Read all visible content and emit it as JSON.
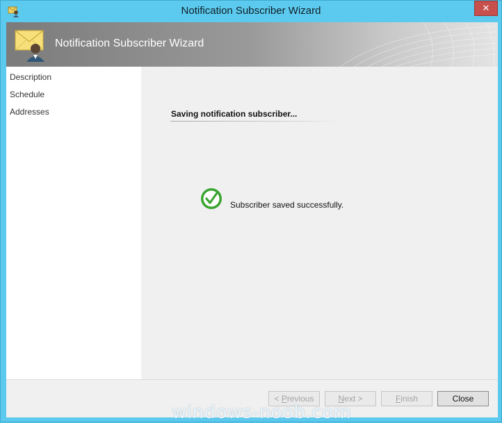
{
  "window": {
    "title": "Notification Subscriber Wizard",
    "close_glyph": "✕"
  },
  "banner": {
    "title": "Notification Subscriber Wizard",
    "icon": "envelope-user-icon"
  },
  "steps": [
    {
      "label": "Description"
    },
    {
      "label": "Schedule"
    },
    {
      "label": "Addresses"
    }
  ],
  "main": {
    "heading": "Saving notification subscriber...",
    "status_text": "Subscriber saved successfully.",
    "status_icon": "check-circle-icon"
  },
  "buttons": {
    "previous": {
      "prefix": "< ",
      "mnemonic": "P",
      "rest": "revious",
      "enabled": false
    },
    "next": {
      "mnemonic": "N",
      "rest": "ext >",
      "enabled": false
    },
    "finish": {
      "mnemonic": "F",
      "rest": "inish",
      "enabled": false
    },
    "close": {
      "label": "Close",
      "enabled": true
    }
  },
  "watermark": "windows-noob.com",
  "colors": {
    "frame": "#5ccaee",
    "close_button": "#c74f4c",
    "success_green": "#3aa42f"
  }
}
